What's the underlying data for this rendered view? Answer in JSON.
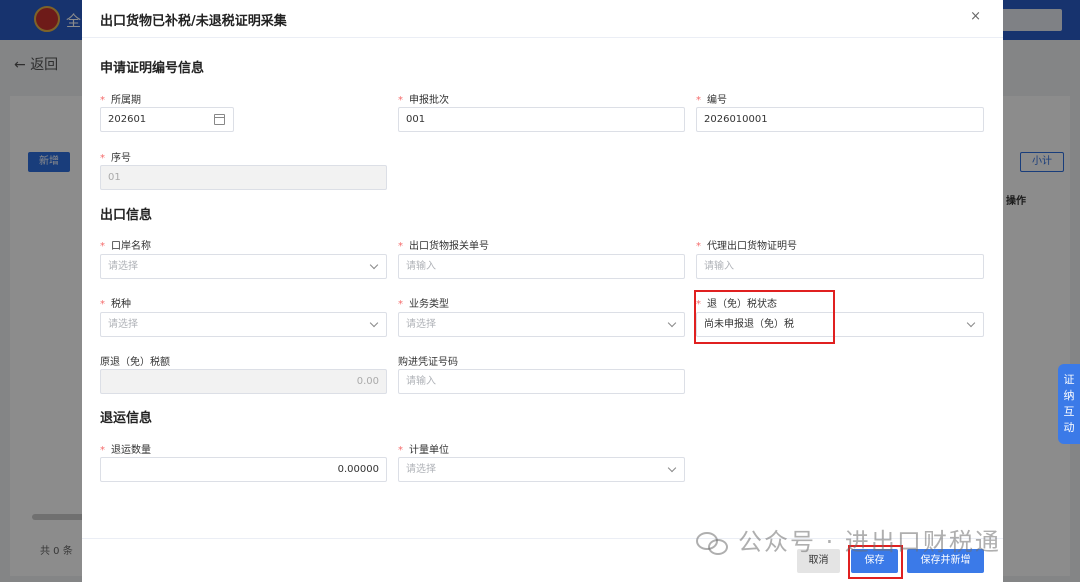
{
  "background": {
    "app_title": "全",
    "back_label": "返回",
    "new_button": "新增",
    "subtotal_button": "小计",
    "operation_header": "操作",
    "total_text": "共 0 条"
  },
  "side_tab": {
    "label": "证纳互动"
  },
  "dialog": {
    "title": "出口货物已补税/未退税证明采集",
    "close_icon": "×",
    "sections": {
      "cert_info": "申请证明编号信息",
      "export_info": "出口信息",
      "return_info": "退运信息"
    },
    "fields": {
      "period_label": "所属期",
      "period_value": "202601",
      "batch_label": "申报批次",
      "batch_value": "001",
      "number_label": "编号",
      "number_value": "2026010001",
      "seq_label": "序号",
      "seq_value": "01",
      "port_label": "口岸名称",
      "port_placeholder": "请选择",
      "customs_label": "出口货物报关单号",
      "customs_placeholder": "请输入",
      "agent_label": "代理出口货物证明号",
      "agent_placeholder": "请输入",
      "tax_type_label": "税种",
      "tax_type_placeholder": "请选择",
      "biz_type_label": "业务类型",
      "biz_type_placeholder": "请选择",
      "refund_status_label": "退（免）税状态",
      "refund_status_value": "尚未申报退（免）税",
      "orig_refund_label": "原退（免）税额",
      "orig_refund_value": "0.00",
      "purchase_voucher_label": "购进凭证号码",
      "purchase_voucher_placeholder": "请输入",
      "return_qty_label": "退运数量",
      "return_qty_value": "0.00000",
      "unit_label": "计量单位",
      "unit_placeholder": "请选择"
    },
    "footer": {
      "cancel": "取消",
      "save": "保存",
      "save_new": "保存并新增"
    }
  },
  "watermark": "公众号 · 进出口财税通",
  "colors": {
    "primary": "#3b7ae8",
    "required": "#f56c6c",
    "highlight": "#e02020"
  }
}
